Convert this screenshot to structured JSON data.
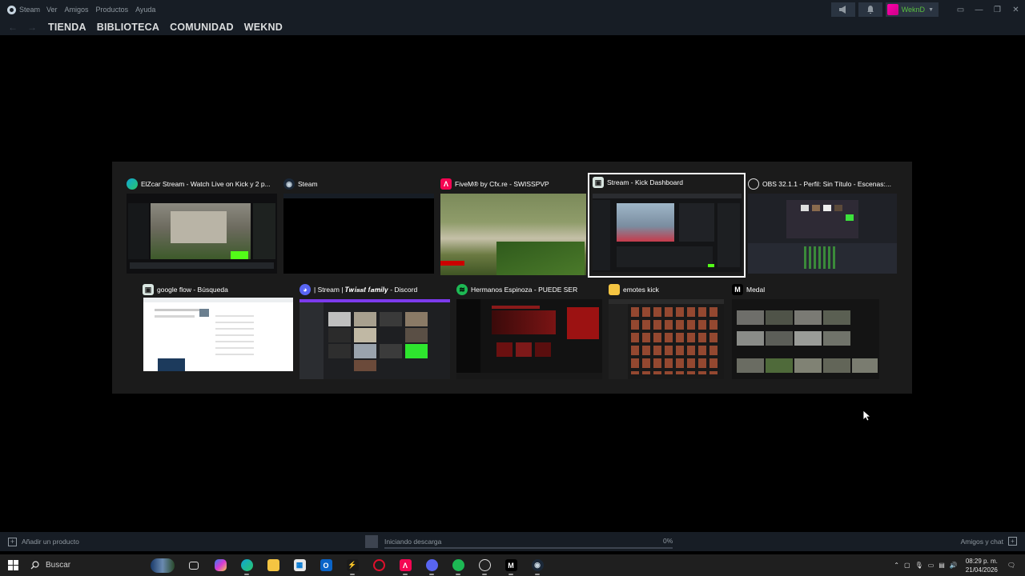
{
  "titlebar": {
    "app_name": "Steam",
    "menu": [
      "Ver",
      "Amigos",
      "Productos",
      "Ayuda"
    ],
    "username": "WeknD"
  },
  "nav": {
    "links": [
      "TIENDA",
      "BIBLIOTECA",
      "COMUNIDAD",
      "WEKND"
    ]
  },
  "switcher": {
    "windows": [
      {
        "title": "ElZcar Stream - Watch Live on Kick y 2 p...",
        "icon": "edge-icon"
      },
      {
        "title": "Steam",
        "icon": "steam-icon"
      },
      {
        "title": "FiveM® by Cfx.re - SWISSPVP",
        "icon": "fivem-icon"
      },
      {
        "title": "Stream - Kick Dashboard",
        "icon": "kick-icon",
        "selected": true
      },
      {
        "title": "OBS 32.1.1 - Perfil: Sin Título - Escenas:...",
        "icon": "obs-icon"
      },
      {
        "title": "google flow - Búsqueda",
        "icon": "browser-icon"
      },
      {
        "title": "| Stream | 𝑻𝒘𝒊𝒔𝒔𝒕 𝒇𝒂𝒎𝒊𝒍𝒚 - Discord",
        "icon": "discord-icon"
      },
      {
        "title": "Hermanos Espinoza - PUEDE SER",
        "icon": "spotify-icon"
      },
      {
        "title": "emotes kick",
        "icon": "folder-icon"
      },
      {
        "title": "Medal",
        "icon": "medal-icon"
      }
    ]
  },
  "bottombar": {
    "add_product": "Añadir un producto",
    "download_status": "Iniciando descarga",
    "download_percent": "0%",
    "download_progress": 0,
    "friends": "Amigos y chat"
  },
  "taskbar": {
    "search_placeholder": "Buscar",
    "time": "08:29 p. m.",
    "date": "21/04/2026"
  },
  "colors": {
    "steam_bar": "#171d25",
    "user_green": "#59bf40",
    "switcher_bg": "#1b1b1b"
  }
}
